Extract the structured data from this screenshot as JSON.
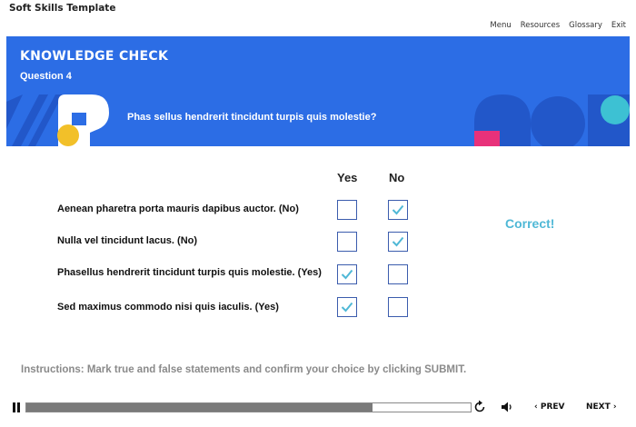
{
  "app": {
    "title": "Soft Skills Template"
  },
  "nav": [
    "Menu",
    "Resources",
    "Glossary",
    "Exit"
  ],
  "banner": {
    "heading": "KNOWLEDGE CHECK",
    "question_number": "Question 4",
    "question": "Phas sellus hendrerit tincidunt turpis quis molestie?"
  },
  "columns": {
    "yes": "Yes",
    "no": "No"
  },
  "statements": [
    {
      "text": "Aenean pharetra porta mauris dapibus auctor. (No)",
      "yes_checked": false,
      "no_checked": true
    },
    {
      "text": "Nulla vel tincidunt lacus. (No)",
      "yes_checked": false,
      "no_checked": true
    },
    {
      "text": "Phasellus hendrerit tincidunt turpis quis molestie. (Yes)",
      "yes_checked": true,
      "no_checked": false
    },
    {
      "text": "Sed maximus commodo nisi quis iaculis. (Yes)",
      "yes_checked": true,
      "no_checked": false
    }
  ],
  "feedback": "Correct!",
  "instructions": "Instructions: Mark true and false statements and confirm your choice by clicking SUBMIT.",
  "player": {
    "progress": 0.78,
    "prev_label": "PREV",
    "next_label": "NEXT",
    "icons": [
      "pause-icon",
      "replay-icon",
      "volume-icon",
      "chevron-left-icon",
      "chevron-right-icon"
    ]
  },
  "colors": {
    "banner": "#2c6de5",
    "accent_check": "#4fb8d6",
    "feedback": "#4fb8d6",
    "deco_yellow": "#f2c029",
    "deco_pink": "#e8317a",
    "deco_teal": "#3dc1d3",
    "deco_dark_blue": "#2257c9"
  }
}
